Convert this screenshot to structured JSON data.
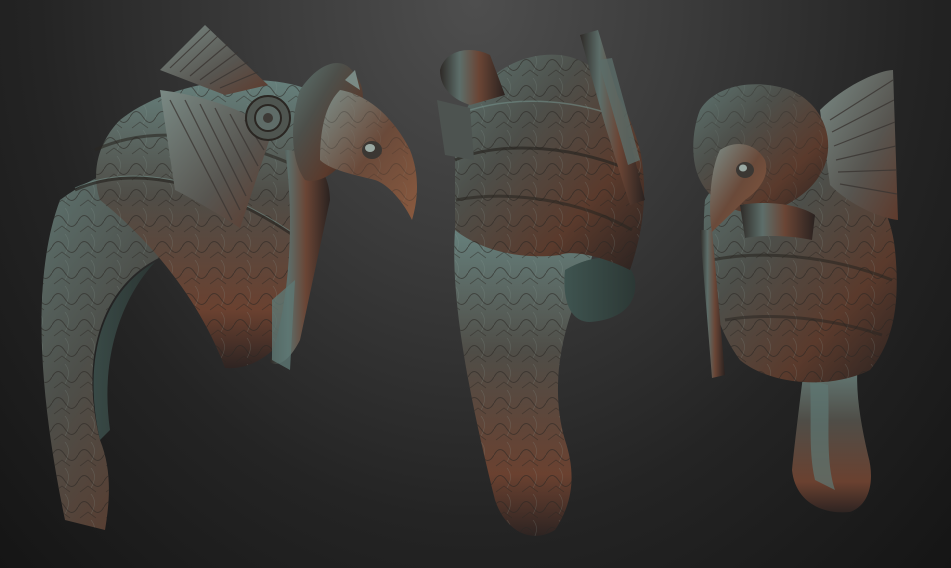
{
  "scene": {
    "background_colors": [
      "#4e4e4e",
      "#151515"
    ],
    "material_colors": {
      "base": "#4a4a45",
      "teal_highlight": "#6e8a86",
      "copper_shadow": "#6b3f2a",
      "engraving": "#2a2622"
    },
    "views": [
      {
        "id": "helmet-view-side",
        "icon": "falcon-helmet-side-view"
      },
      {
        "id": "helmet-view-back",
        "icon": "falcon-helmet-back-view"
      },
      {
        "id": "helmet-view-front",
        "icon": "falcon-helmet-front-view"
      }
    ]
  }
}
